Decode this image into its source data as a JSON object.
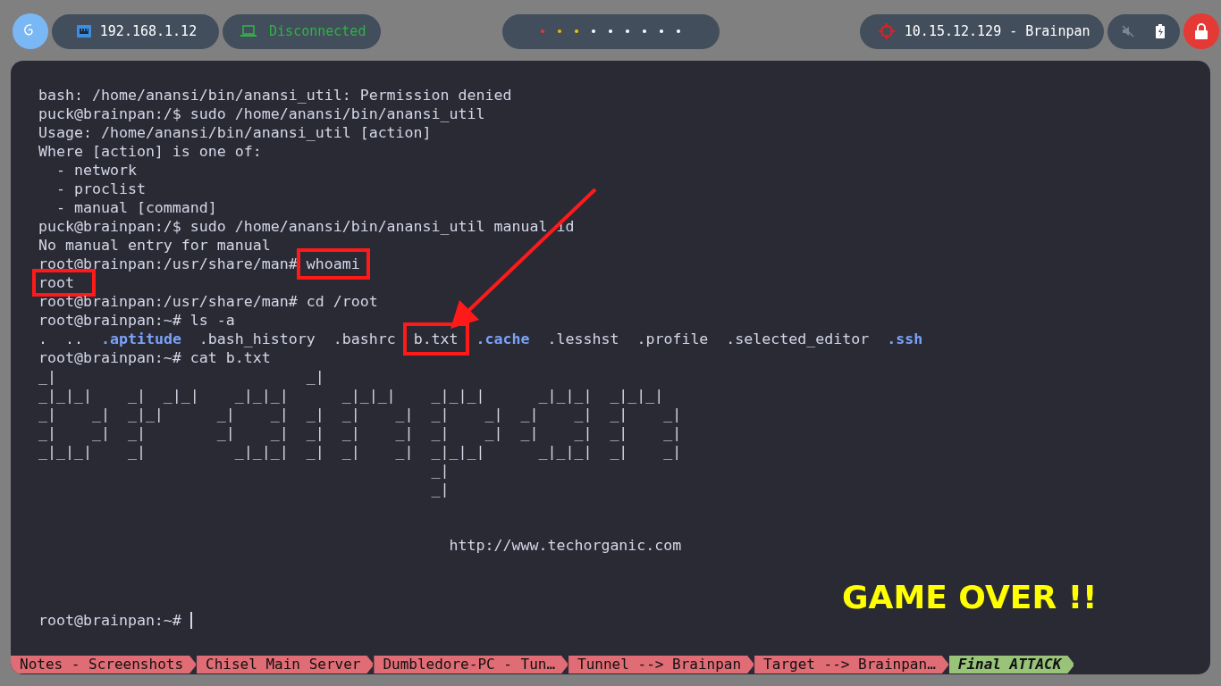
{
  "topbar": {
    "network": "192.168.1.12",
    "vpn": "Disconnected",
    "workspaces": [
      {
        "color": "#e53935"
      },
      {
        "color": "#f4b400"
      },
      {
        "color": "#f4c20d"
      },
      {
        "color": "#ffffff"
      },
      {
        "color": "#ffffff"
      },
      {
        "color": "#ffffff"
      },
      {
        "color": "#ffffff"
      },
      {
        "color": "#ffffff"
      },
      {
        "color": "#ffffff"
      }
    ],
    "target": "10.15.12.129 - Brainpan"
  },
  "terminal": {
    "lines": [
      {
        "kind": "text",
        "text": "bash: /home/anansi/bin/anansi_util: Permission denied"
      },
      {
        "kind": "text",
        "text": "puck@brainpan:/$ sudo /home/anansi/bin/anansi_util"
      },
      {
        "kind": "text",
        "text": "Usage: /home/anansi/bin/anansi_util [action]"
      },
      {
        "kind": "text",
        "text": "Where [action] is one of:"
      },
      {
        "kind": "text",
        "text": "  - network"
      },
      {
        "kind": "text",
        "text": "  - proclist"
      },
      {
        "kind": "text",
        "text": "  - manual [command]"
      },
      {
        "kind": "text",
        "text": "puck@brainpan:/$ sudo /home/anansi/bin/anansi_util manual id"
      },
      {
        "kind": "text",
        "text": "No manual entry for manual"
      },
      {
        "kind": "cmd",
        "prompt": "root@brainpan:/usr/share/man# ",
        "command": "whoami",
        "highlighted": true
      },
      {
        "kind": "output",
        "text": "root",
        "highlighted": true
      },
      {
        "kind": "text",
        "text": "root@brainpan:/usr/share/man# cd /root"
      },
      {
        "kind": "text",
        "text": "root@brainpan:~# ls -a"
      },
      {
        "kind": "ls",
        "entries": [
          {
            "text": ".",
            "kind": "file"
          },
          {
            "text": "..",
            "kind": "file"
          },
          {
            "text": ".aptitude",
            "kind": "dir"
          },
          {
            "text": ".bash_history",
            "kind": "file"
          },
          {
            "text": ".bashrc",
            "kind": "file"
          },
          {
            "text": "b.txt",
            "kind": "file",
            "highlighted": true
          },
          {
            "text": ".cache",
            "kind": "dir"
          },
          {
            "text": ".lesshst",
            "kind": "file"
          },
          {
            "text": ".profile",
            "kind": "file"
          },
          {
            "text": ".selected_editor",
            "kind": "file"
          },
          {
            "text": ".ssh",
            "kind": "dir"
          }
        ]
      },
      {
        "kind": "text",
        "text": "root@brainpan:~# cat b.txt"
      },
      {
        "kind": "text",
        "text": "_|                            _|"
      },
      {
        "kind": "text",
        "text": "_|_|_|    _|  _|_|    _|_|_|      _|_|_|    _|_|_|      _|_|_|  _|_|_|"
      },
      {
        "kind": "text",
        "text": "_|    _|  _|_|      _|    _|  _|  _|    _|  _|    _|  _|    _|  _|    _|"
      },
      {
        "kind": "text",
        "text": "_|    _|  _|        _|    _|  _|  _|    _|  _|    _|  _|    _|  _|    _|"
      },
      {
        "kind": "text",
        "text": "_|_|_|    _|          _|_|_|  _|  _|    _|  _|_|_|      _|_|_|  _|    _|"
      },
      {
        "kind": "text",
        "text": "                                            _|"
      },
      {
        "kind": "text",
        "text": "                                            _|"
      },
      {
        "kind": "blank"
      },
      {
        "kind": "blank"
      },
      {
        "kind": "text",
        "text": "                                              http://www.techorganic.com"
      },
      {
        "kind": "blank"
      },
      {
        "kind": "blank"
      },
      {
        "kind": "blank"
      },
      {
        "kind": "prompt",
        "text": "root@brainpan:~# "
      }
    ],
    "banner": "GAME OVER !!",
    "tabs": [
      {
        "label": "Notes - Screenshots",
        "selected": false
      },
      {
        "label": "Chisel Main Server",
        "selected": false
      },
      {
        "label": "Dumbledore-PC - Tun…",
        "selected": false
      },
      {
        "label": "Tunnel --> Brainpan",
        "selected": false
      },
      {
        "label": "Target --> Brainpan…",
        "selected": false
      },
      {
        "label": "Final ATTACK",
        "selected": true
      }
    ]
  }
}
